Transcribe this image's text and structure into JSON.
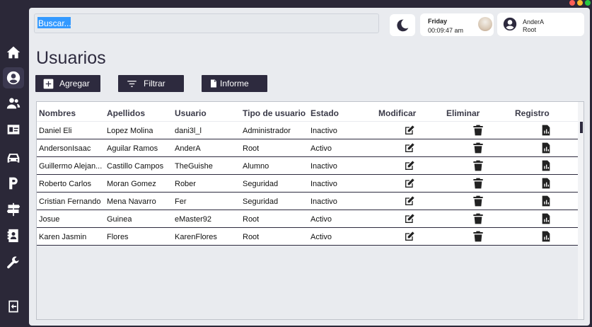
{
  "colors": {
    "primary": "#2d2a3e",
    "panel": "#e9ebef",
    "selection": "#3399ff"
  },
  "window_dots": [
    "#ff5f57",
    "#febc2e",
    "#28c840"
  ],
  "sidebar": {
    "items": [
      {
        "icon": "home-icon"
      },
      {
        "icon": "user-circle-icon"
      },
      {
        "icon": "users-icon"
      },
      {
        "icon": "id-card-icon"
      },
      {
        "icon": "car-icon"
      },
      {
        "icon": "parking-icon"
      },
      {
        "icon": "signpost-icon"
      },
      {
        "icon": "contact-book-icon"
      },
      {
        "icon": "wrench-icon"
      },
      {
        "icon": "logout-icon"
      }
    ]
  },
  "header": {
    "search_placeholder": "Buscar...",
    "theme_icon": "moon-icon",
    "day": "Friday",
    "time": "00:09:47 am",
    "user_name": "AnderA",
    "user_role": "Root"
  },
  "page": {
    "title": "Usuarios",
    "buttons": {
      "add": "Agregar",
      "filter": "Filtrar",
      "report": "Informe"
    }
  },
  "table": {
    "columns": [
      "Nombres",
      "Apellidos",
      "Usuario",
      "Tipo de usuario",
      "Estado",
      "Modificar",
      "Eliminar",
      "Registro"
    ],
    "rows": [
      {
        "nombres": "Daniel Eli",
        "apellidos": "Lopez Molina",
        "usuario": "dani3l_l",
        "tipo": "Administrador",
        "estado": "Inactivo"
      },
      {
        "nombres": "AndersonIsaac",
        "apellidos": "Aguilar Ramos",
        "usuario": "AnderA",
        "tipo": "Root",
        "estado": "Activo"
      },
      {
        "nombres": "Guillermo Alejan...",
        "apellidos": "Castillo Campos",
        "usuario": "TheGuishe",
        "tipo": "Alumno",
        "estado": "Inactivo"
      },
      {
        "nombres": "Roberto Carlos",
        "apellidos": "Moran Gomez",
        "usuario": "Rober",
        "tipo": "Seguridad",
        "estado": "Inactivo"
      },
      {
        "nombres": "Cristian Fernando",
        "apellidos": "Mena Navarro",
        "usuario": "Fer",
        "tipo": "Seguridad",
        "estado": "Inactivo"
      },
      {
        "nombres": "Josue",
        "apellidos": "Guinea",
        "usuario": "eMaster92",
        "tipo": "Root",
        "estado": "Activo"
      },
      {
        "nombres": "Karen Jasmin",
        "apellidos": "Flores",
        "usuario": "KarenFlores",
        "tipo": "Root",
        "estado": "Activo"
      }
    ]
  }
}
